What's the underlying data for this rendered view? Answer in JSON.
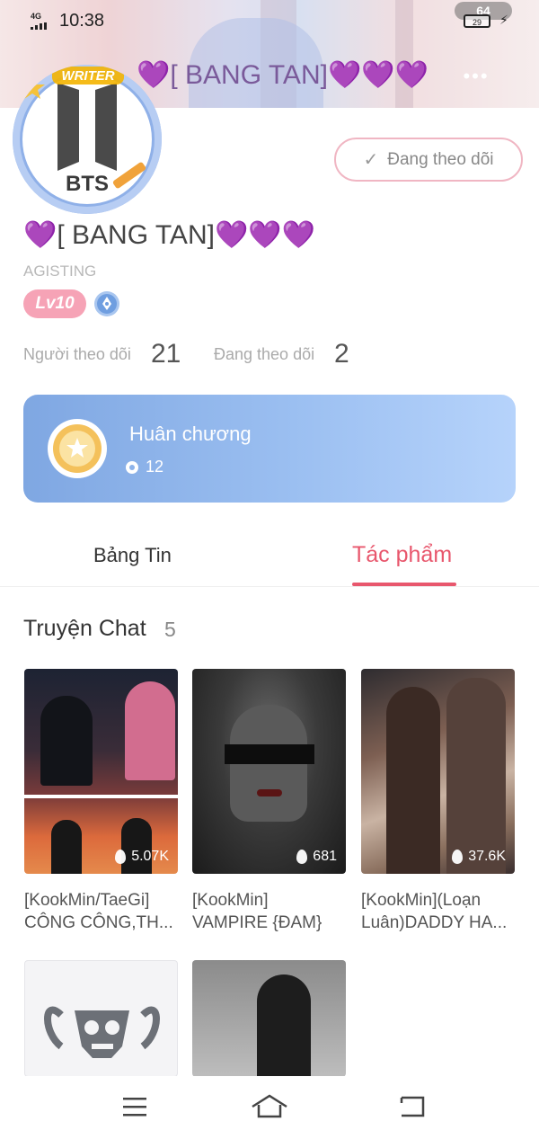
{
  "status_bar": {
    "network": "4G",
    "time": "10:38",
    "pill_value": "64",
    "battery": "29"
  },
  "header": {
    "title": "💜[ BANG TAN]💜💜💜",
    "more_label": "•••"
  },
  "avatar": {
    "badge_text": "WRITER",
    "logo_text": "BTS"
  },
  "follow_button": {
    "label": "Đang theo dõi"
  },
  "profile": {
    "name": "💜[ BANG TAN]💜💜💜",
    "handle": "AGISTING",
    "level": "Lv10",
    "followers_label": "Người theo dõi",
    "followers": "21",
    "following_label": "Đang theo dõi",
    "following": "2"
  },
  "medal": {
    "title": "Huân chương",
    "count": "12"
  },
  "tabs": [
    {
      "label": "Bảng Tin",
      "active": false
    },
    {
      "label": "Tác phẩm",
      "active": true
    }
  ],
  "section": {
    "title": "Truyện Chat",
    "count": "5"
  },
  "stories": [
    {
      "title_line1": "[KookMin/TaeGi]",
      "title_line2": "CÔNG CÔNG,TH...",
      "views": "5.07K"
    },
    {
      "title_line1": "[KookMin]",
      "title_line2": "VAMPIRE {ĐAM}",
      "views": "681"
    },
    {
      "title_line1": "[KookMin](Loạn",
      "title_line2": "Luân)DADDY HA...",
      "views": "37.6K"
    }
  ],
  "colors": {
    "accent": "#e8576d",
    "follow_border": "#f0b6c3",
    "level_badge": "#f6a3b6",
    "medal_card": "#8db3ea"
  },
  "icons": {
    "more": "more-icon",
    "check": "check-icon",
    "pen": "pen-badge-icon",
    "medal": "medal-icon",
    "flame": "flame-icon",
    "menu": "menu-icon",
    "home": "home-icon",
    "back": "back-icon"
  }
}
